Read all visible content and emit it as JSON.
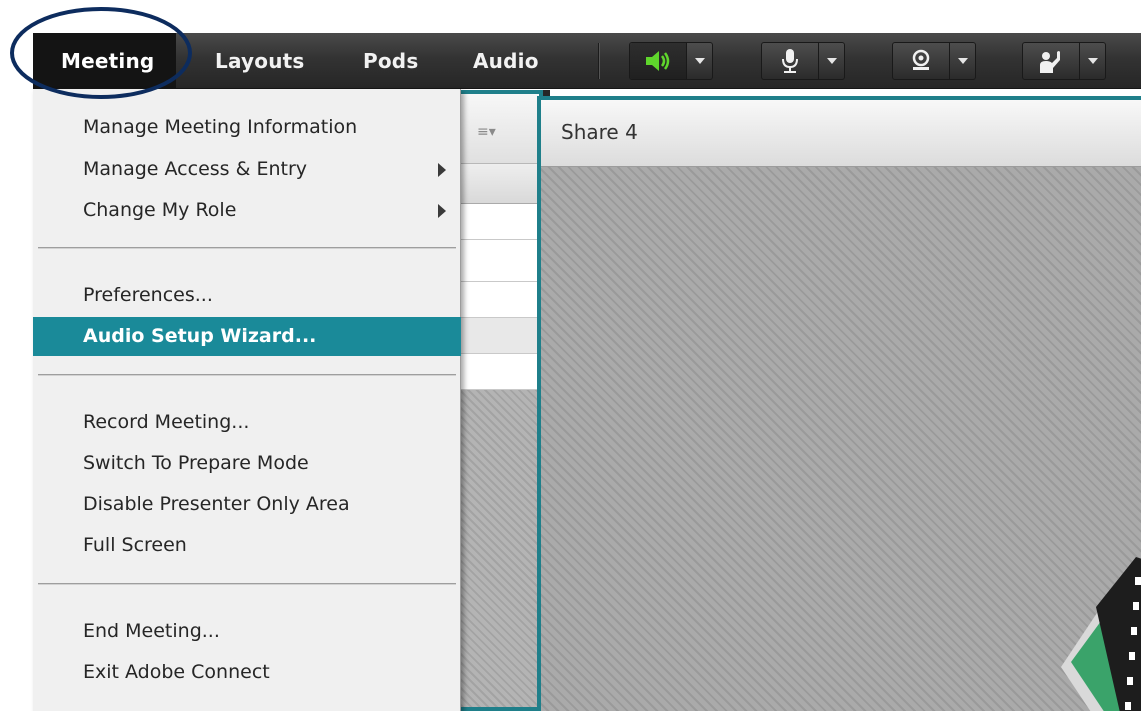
{
  "menubar": {
    "menus": [
      "Meeting",
      "Layouts",
      "Pods",
      "Audio"
    ],
    "controls": {
      "speaker": "speaker-icon",
      "microphone": "microphone-icon",
      "webcam": "webcam-icon",
      "raise_hand": "raise-hand-icon",
      "dropdown": "dropdown-caret-icon"
    },
    "colors": {
      "speaker_active": "#5fd62c",
      "bar": "#333333"
    }
  },
  "meeting_menu": {
    "items": [
      {
        "label": "Manage Meeting Information",
        "submenu": false
      },
      {
        "label": "Manage Access & Entry",
        "submenu": true
      },
      {
        "label": "Change My Role",
        "submenu": true
      },
      {
        "label": "Preferences...",
        "submenu": false
      },
      {
        "label": "Audio Setup Wizard...",
        "submenu": false,
        "highlighted": true
      },
      {
        "label": "Record Meeting...",
        "submenu": false
      },
      {
        "label": "Switch To Prepare Mode",
        "submenu": false
      },
      {
        "label": "Disable Presenter Only Area",
        "submenu": false
      },
      {
        "label": "Full Screen",
        "submenu": false
      },
      {
        "label": "End Meeting...",
        "submenu": false
      },
      {
        "label": "Exit Adobe Connect",
        "submenu": false
      }
    ],
    "highlight_color": "#1a8a99"
  },
  "share_pod": {
    "title": "Share 4",
    "accent": "#1f7f8a"
  },
  "left_pod": {
    "menu_icon": "pod-menu-icon"
  },
  "annotation": {
    "shape": "ellipse",
    "color": "#0d2c5e",
    "target": "Meeting"
  }
}
